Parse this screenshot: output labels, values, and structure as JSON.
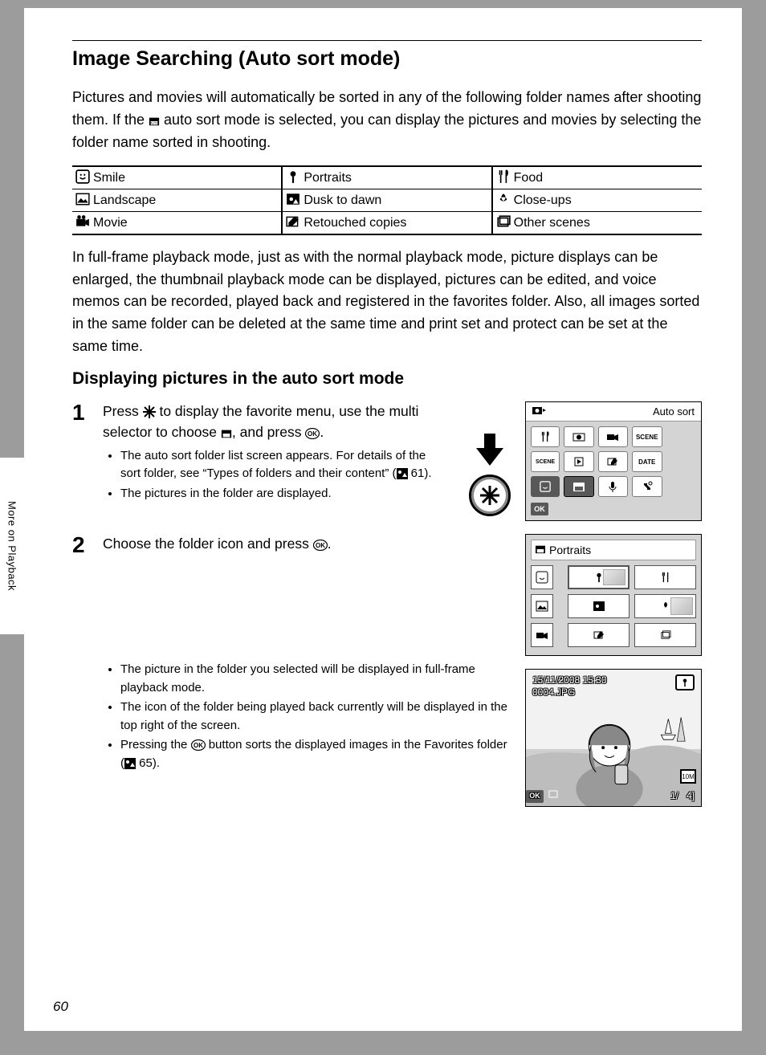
{
  "side_tab": "More on Playback",
  "page_number": "60",
  "title": "Image Searching (Auto sort mode)",
  "intro_before": "Pictures and movies will automatically be sorted in any of the following folder names after shooting them. If the ",
  "intro_after": " auto sort mode is selected, you can display the pictures and movies by selecting the folder name sorted in shooting.",
  "folder_table": [
    [
      "Smile",
      "Portraits",
      "Food"
    ],
    [
      "Landscape",
      "Dusk to dawn",
      "Close-ups"
    ],
    [
      "Movie",
      "Retouched copies",
      "Other scenes"
    ]
  ],
  "para_after_table": "In full-frame playback mode, just as with the normal playback mode, picture displays can be enlarged, the thumbnail playback mode can be displayed, pictures can be edited, and voice memos can be recorded, played back and registered in the favorites folder. Also, all images sorted in the same folder can be deleted at the same time and print set and protect can be set at the same time.",
  "subtitle": "Displaying pictures in the auto sort mode",
  "step1": {
    "num": "1",
    "main_a": "Press ",
    "main_b": " to display the favorite menu, use the multi selector to choose ",
    "main_c": ", and press ",
    "main_d": ".",
    "bullets": [
      "The auto sort folder list screen appears. For details of the sort folder, see “Types of folders and their content” (",
      " 61).",
      "The pictures in the folder are displayed."
    ]
  },
  "step2": {
    "num": "2",
    "main_a": "Choose the folder icon and press ",
    "main_b": ".",
    "bullets_a": "The picture in the folder you selected will be displayed in full-frame playback mode.",
    "bullets_b": "The icon of the folder being played back currently will be displayed in the top right of the screen.",
    "bullets_c_pre": "Pressing the ",
    "bullets_c_post": " button sorts the displayed images in the Favorites folder (",
    "bullets_c_end": " 65)."
  },
  "fig1_header": "Auto sort",
  "fig2_header": "Portraits",
  "fig3": {
    "date": "15/11/2008 15:30",
    "file": "0004.JPG",
    "count": "1/",
    "total": "4",
    "res": "10M"
  }
}
